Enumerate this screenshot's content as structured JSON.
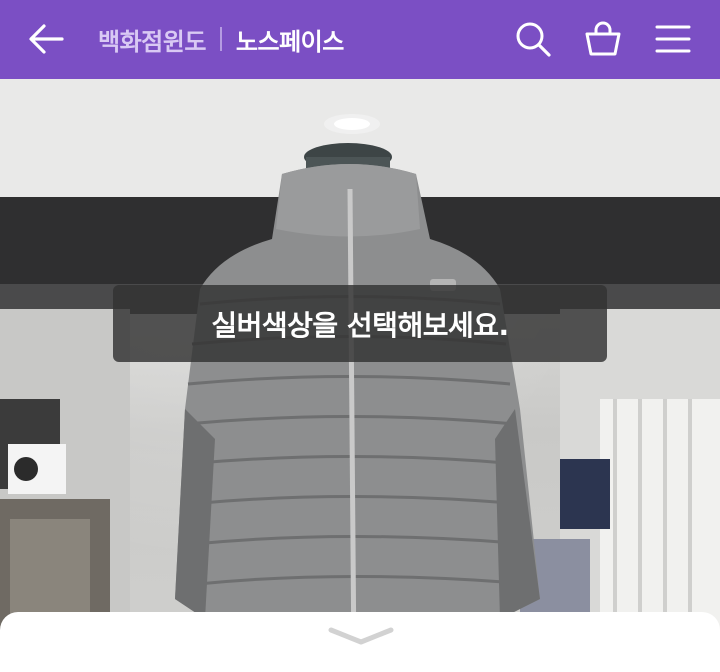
{
  "header": {
    "category": "백화점윈도",
    "brand": "노스페이스",
    "background": "#7b4fc4",
    "icons": [
      "back-arrow-icon",
      "search-icon",
      "shopping-bag-icon",
      "menu-icon"
    ]
  },
  "toast": {
    "message": "실버색상을 선택해보세요."
  },
  "sheet": {
    "handle_icon": "chevron-down-icon"
  }
}
